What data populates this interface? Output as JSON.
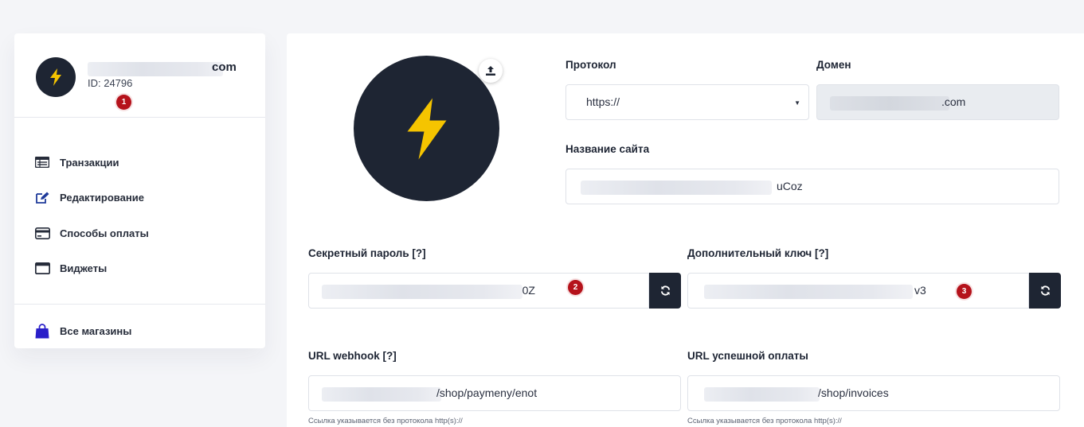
{
  "sidebar": {
    "profile": {
      "domain_suffix": "com",
      "id_label": "ID: 24796",
      "marker": "1"
    },
    "menu": [
      {
        "label": "Транзакции",
        "icon": "table-list-icon"
      },
      {
        "label": "Редактирование",
        "icon": "edit-icon"
      },
      {
        "label": "Способы оплаты",
        "icon": "credit-card-icon"
      },
      {
        "label": "Виджеты",
        "icon": "window-icon"
      }
    ],
    "stores": {
      "label": "Все магазины",
      "icon": "shopping-bag-icon"
    }
  },
  "form": {
    "protocol": {
      "label": "Протокол",
      "value": "https://"
    },
    "domain": {
      "label": "Домен",
      "value_suffix": ".com"
    },
    "site_name": {
      "label": "Название сайта",
      "value_suffix": "uCoz"
    },
    "secret": {
      "label": "Секретный пароль [?]",
      "value_suffix": "  0Z",
      "marker": "2"
    },
    "extra_key": {
      "label": "Дополнительный ключ [?]",
      "value_suffix": "v3",
      "marker": "3"
    },
    "webhook": {
      "label": "URL webhook [?]",
      "value_suffix": "/shop/paymeny/enot",
      "hint": "Ссылка указывается без протокола http(s)://"
    },
    "success": {
      "label": "URL успешной оплаты",
      "value_suffix": "/shop/invoices",
      "hint": "Ссылка указывается без протокола http(s)://"
    }
  },
  "colors": {
    "dark": "#1e2533",
    "accent_bolt": "#f5c400",
    "store_icon": "#2a1fc9",
    "marker": "#b5121b"
  }
}
